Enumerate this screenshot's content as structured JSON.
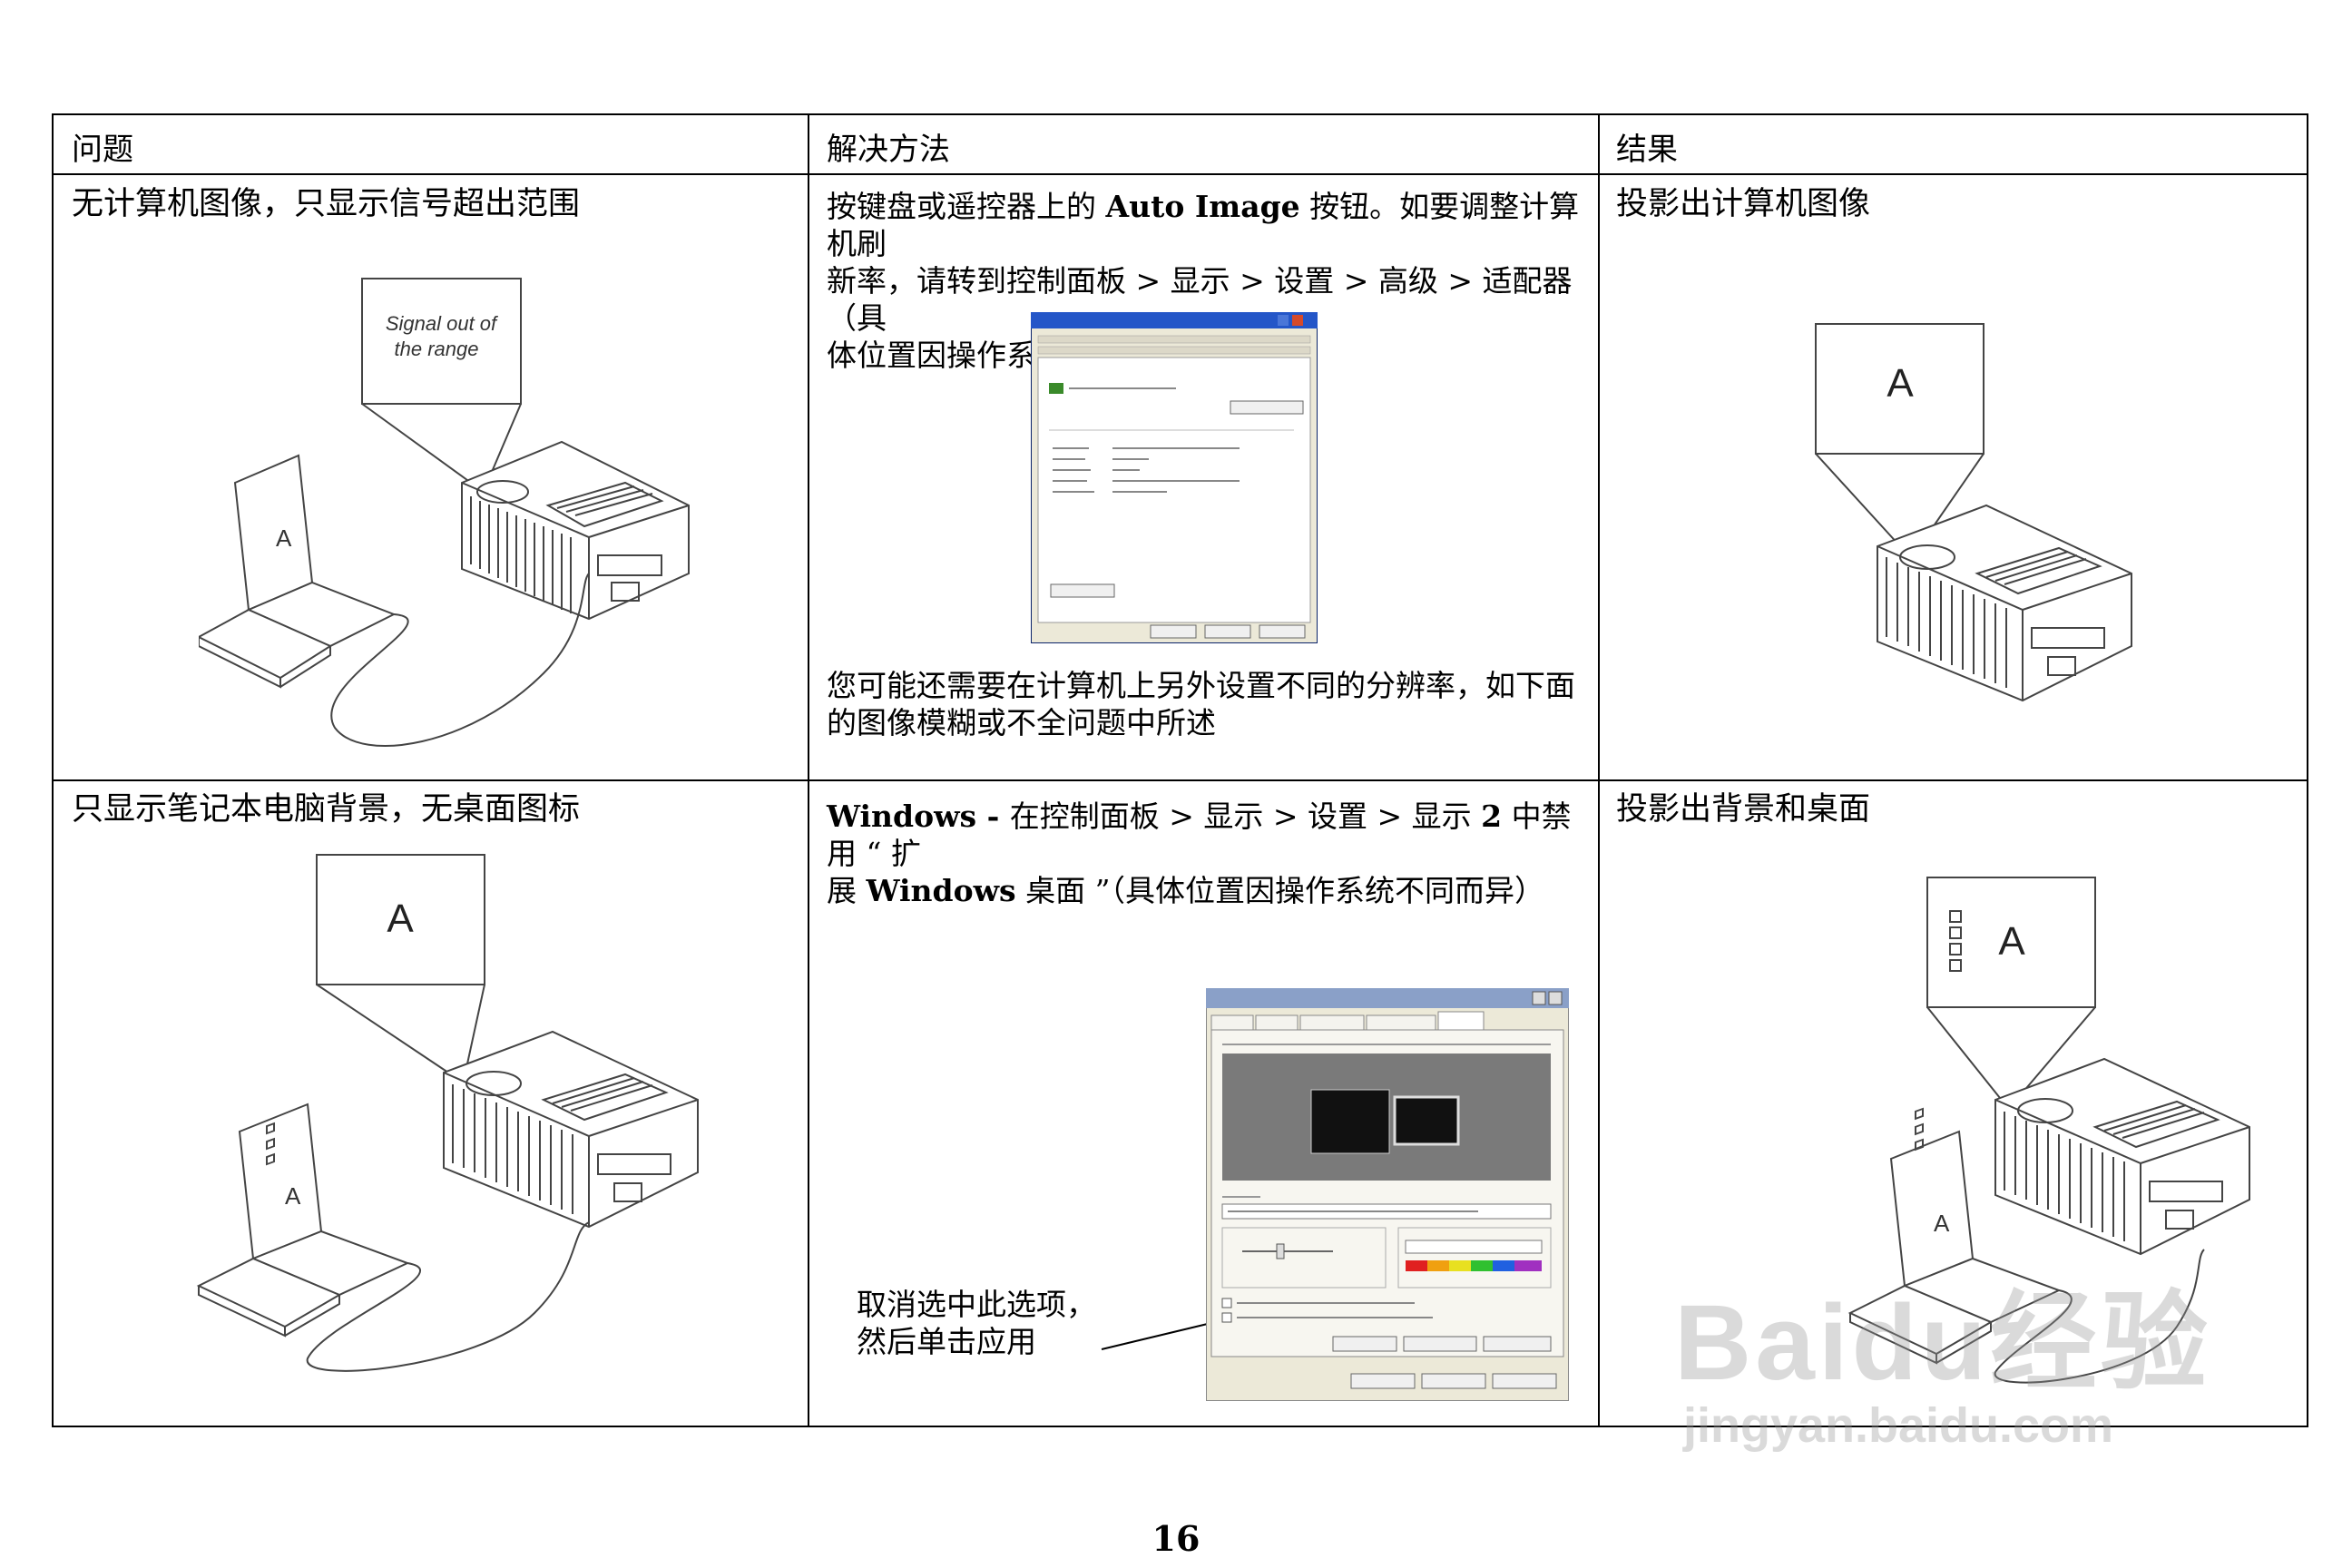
{
  "table": {
    "headers": [
      "问题",
      "解决方法",
      "结果"
    ],
    "rows": [
      {
        "problem": "无计算机图像，只显示信号超出范围",
        "solution_parts": [
          "按键盘或遥控器上的 ",
          "Auto Image",
          " 按钮。如要调整计算机刷",
          "新率，请转到控制面板 > 显示 > 设置 > 高级 > 适配器 （具",
          "体位置因操作系统不同而异）。”"
        ],
        "solution_note_lines": [
          "您可能还需要在计算机上另外设置不同的分辨率，如下面",
          "的图像模糊或不全问题中所述"
        ],
        "result": "投影出计算机图像",
        "screen_text_lines": [
          "Signal out of",
          "the range"
        ],
        "laptop_letter": "A",
        "result_letter": "A"
      },
      {
        "problem": "只显示笔记本电脑背景，无桌面图标",
        "solution_line1_parts": [
          "Windows - ",
          "在控制面板 > 显示 > 设置 > 显示 ",
          "2",
          " 中禁用 “ 扩"
        ],
        "solution_line2_parts": [
          "展 ",
          "Windows",
          " 桌面 ”（具体位置因操作系统不同而异）"
        ],
        "callout_lines": [
          "取消选中此选项，",
          "然后单击应用"
        ],
        "result": "投影出背景和桌面",
        "screen_letter": "A",
        "laptop_letter": "A",
        "result_letter": "A"
      }
    ]
  },
  "page_number": "16",
  "watermark": {
    "brand": "Baidu经验",
    "url": "jingyan.baidu.com"
  }
}
